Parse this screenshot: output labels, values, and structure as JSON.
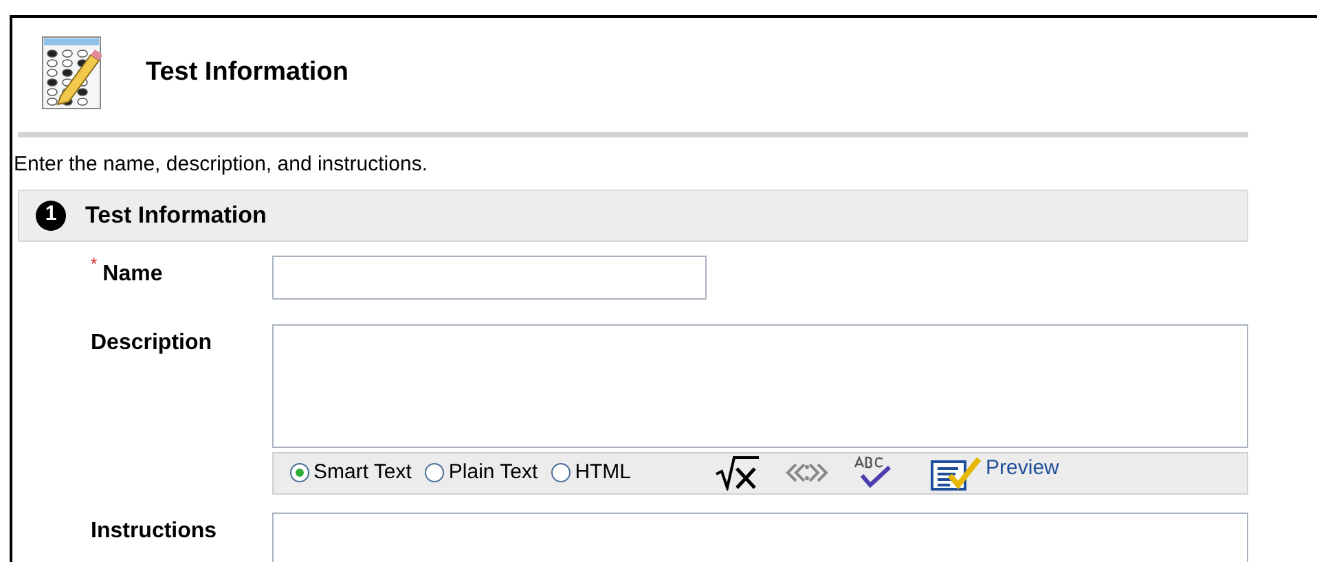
{
  "header": {
    "title": "Test Information"
  },
  "intro": "Enter the name, description, and instructions.",
  "section": {
    "number": "1",
    "title": "Test Information"
  },
  "fields": [
    {
      "kind": "input",
      "label": "Name",
      "required_mark": "*"
    },
    {
      "kind": "editor",
      "label": "Description",
      "modes": [
        {
          "label": "Smart Text",
          "selected": true
        },
        {
          "label": "Plain Text",
          "selected": false
        },
        {
          "label": "HTML",
          "selected": false
        }
      ],
      "preview": "Preview"
    },
    {
      "kind": "editor_cut",
      "label": "Instructions"
    }
  ]
}
